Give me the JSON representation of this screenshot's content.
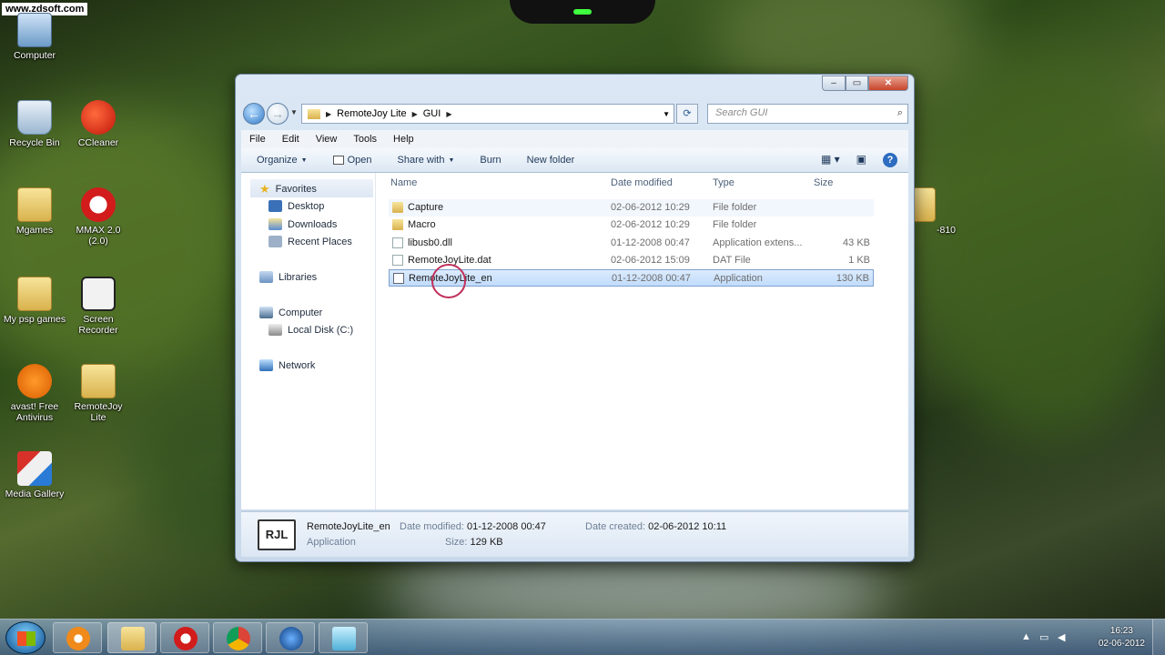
{
  "watermark": "www.zdsoft.com",
  "desktop_icons": {
    "computer": "Computer",
    "recycle_bin": "Recycle Bin",
    "ccleaner": "CCleaner",
    "mgames_line1": "Mgames",
    "mmax_line1": "MMAX 2.0",
    "mmax_line2": "(2.0)",
    "my_psp_games": "My psp games",
    "screen_recorder": "Screen Recorder",
    "avast": "avast! Free Antivirus",
    "remotejoy": "RemoteJoy Lite",
    "media_gallery": "Media Gallery",
    "right_folder": "-810"
  },
  "window": {
    "address": {
      "segments": [
        "RemoteJoy Lite",
        "GUI"
      ]
    },
    "search_placeholder": "Search GUI",
    "menu": [
      "File",
      "Edit",
      "View",
      "Tools",
      "Help"
    ],
    "commands": {
      "organize": "Organize",
      "open": "Open",
      "share_with": "Share with",
      "burn": "Burn",
      "new_folder": "New folder"
    },
    "nav": {
      "favorites": "Favorites",
      "desktop": "Desktop",
      "downloads": "Downloads",
      "recent_places": "Recent Places",
      "libraries": "Libraries",
      "computer": "Computer",
      "local_disk": "Local Disk (C:)",
      "network": "Network"
    },
    "columns": {
      "name": "Name",
      "date_modified": "Date modified",
      "type": "Type",
      "size": "Size"
    },
    "files": [
      {
        "name": "Capture",
        "date": "02-06-2012 10:29",
        "type": "File folder",
        "size": "",
        "icon": "folder-icon"
      },
      {
        "name": "Macro",
        "date": "02-06-2012 10:29",
        "type": "File folder",
        "size": "",
        "icon": "folder-icon"
      },
      {
        "name": "libusb0.dll",
        "date": "01-12-2008 00:47",
        "type": "Application extens...",
        "size": "43 KB",
        "icon": "dll-file-icon"
      },
      {
        "name": "RemoteJoyLite.dat",
        "date": "02-06-2012 15:09",
        "type": "DAT File",
        "size": "1 KB",
        "icon": "dat-file-icon"
      },
      {
        "name": "RemoteJoyLite_en",
        "date": "01-12-2008 00:47",
        "type": "Application",
        "size": "130 KB",
        "icon": "application-icon"
      }
    ],
    "details": {
      "icon_text": "RJL",
      "name": "RemoteJoyLite_en",
      "kind": "Application",
      "date_modified_label": "Date modified:",
      "date_modified": "01-12-2008 00:47",
      "size_label": "Size:",
      "size": "129 KB",
      "date_created_label": "Date created:",
      "date_created": "02-06-2012 10:11"
    }
  },
  "taskbar": {
    "time": "16:23",
    "date": "02-06-2012"
  }
}
